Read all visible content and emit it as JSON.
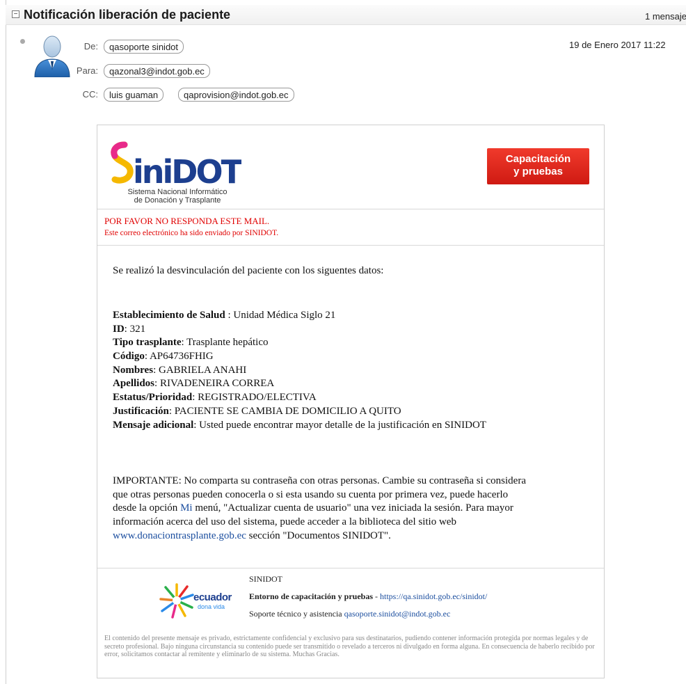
{
  "subject": "Notificación liberación de paciente",
  "message_count": "1 mensaje",
  "header": {
    "from_label": "De:",
    "from": "qasoporte sinidot",
    "to_label": "Para:",
    "to": "qazonal3@indot.gob.ec",
    "cc_label": "CC:",
    "cc": [
      "luis guaman",
      "qaprovision@indot.gob.ec"
    ],
    "date": "19 de Enero 2017 11:22"
  },
  "logo": {
    "name": "SINIDOT",
    "subtitle_1": "Sistema Nacional Informático",
    "subtitle_2": "de Donación y Trasplante"
  },
  "badge": {
    "line1": "Capacitación",
    "line2": "y pruebas"
  },
  "warning": {
    "line1": "POR FAVOR NO RESPONDA ESTE MAIL.",
    "line2": "Este correo electrónico ha sido enviado por SINIDOT."
  },
  "intro": "Se realizó la desvinculación del paciente con los siguentes datos:",
  "fields": [
    {
      "label": "Establecimiento de Salud",
      "sep": " : ",
      "value": "Unidad Médica Siglo 21"
    },
    {
      "label": "ID",
      "sep": ": ",
      "value": "321"
    },
    {
      "label": "Tipo trasplante",
      "sep": ": ",
      "value": "Trasplante hepático"
    },
    {
      "label": "Código",
      "sep": ": ",
      "value": "AP64736FHIG"
    },
    {
      "label": "Nombres",
      "sep": ": ",
      "value": "GABRIELA ANAHI"
    },
    {
      "label": "Apellidos",
      "sep": ": ",
      "value": "RIVADENEIRA CORREA"
    },
    {
      "label": "Estatus/Prioridad",
      "sep": ": ",
      "value": "REGISTRADO/ELECTIVA"
    },
    {
      "label": "Justificación",
      "sep": ": ",
      "value": "PACIENTE SE CAMBIA DE DOMICILIO A QUITO"
    },
    {
      "label": "Mensaje adicional",
      "sep": ": ",
      "value": "Usted puede encontrar mayor detalle de la justificación en SINIDOT"
    }
  ],
  "important": {
    "line1": "IMPORTANTE: No comparta su contraseña con otras personas. Cambie su contraseña si considera",
    "line2": "que otras personas pueden conocerla o si esta usando su cuenta por primera vez, puede hacerlo",
    "line3_pre": "desde la opción ",
    "line3_link": "Mi",
    "line3_post": " menú, \"Actualizar cuenta de usuario\" una vez iniciada la sesión. Para mayor",
    "line4": "información acerca del uso del sistema, puede acceder a la biblioteca del sitio web",
    "line5_link": "www.donaciontrasplante.gob.ec",
    "line5_post": " sección \"Documentos SINIDOT\"."
  },
  "footer": {
    "ecuador_name": "ecuador",
    "ecuador_tagline": "dona vida",
    "org": "SINIDOT",
    "env_label": "Entorno de capacitación y pruebas",
    "env_sep": " - ",
    "env_url": "https://qa.sinidot.gob.ec/sinidot/",
    "support_label": "Soporte técnico y asistencia ",
    "support_email": "qasoporte.sinidot@indot.gob.ec",
    "legal": "El contenido del presente mensaje es privado, estrictamente confidencial y exclusivo para sus destinatarios, pudiendo contener información protegida por normas legales y de secreto profesional. Bajo ninguna circunstancia su contenido puede ser transmitido o revelado a terceros ni divulgado en forma alguna. En consecuencia de haberlo recibido por error, solicitamos contactar al remitente y eliminarlo de su sistema. Muchas Gracias."
  },
  "colors": {
    "warning": "#e00000",
    "link": "#1a4d9e",
    "badge": "#e1251b",
    "logo_blue": "#1d3f8f",
    "logo_yellow": "#f5b800"
  }
}
